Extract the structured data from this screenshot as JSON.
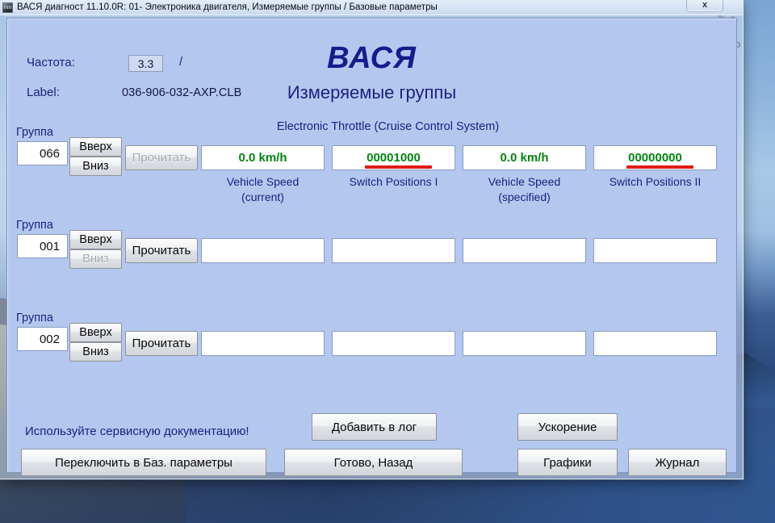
{
  "window": {
    "title": "ВАСЯ диагност 11.10.0R: 01- Электроника двигателя,  Измеряемые группы / Базовые параметры",
    "close_label": "x",
    "icon": "app-icon"
  },
  "desktop": {
    "watermark": "shop"
  },
  "header": {
    "freq_label": "Частота:",
    "freq_value": "3.3",
    "freq_separator": "/",
    "label_caption": "Label:",
    "label_value": "036-906-032-AXP.CLB",
    "brand": "ВАСЯ",
    "subtitle": "Измеряемые группы",
    "section_title": "Electronic Throttle (Cruise Control System)"
  },
  "groups": [
    {
      "caption": "Группа",
      "number": "066",
      "up_label": "Вверх",
      "down_label": "Вниз",
      "read_label": "Прочитать",
      "read_enabled": false,
      "up_enabled": true,
      "down_enabled": true,
      "fields": [
        {
          "value": "0.0 km/h",
          "label": "Vehicle Speed\n(current)",
          "label_line1": "Vehicle Speed",
          "label_line2": "(current)",
          "underlined": false
        },
        {
          "value": "00001000",
          "label": "Switch Positions I",
          "label_line1": "Switch Positions I",
          "label_line2": "",
          "underlined": true
        },
        {
          "value": "0.0 km/h",
          "label": "Vehicle Speed\n(specified)",
          "label_line1": "Vehicle Speed",
          "label_line2": "(specified)",
          "underlined": false
        },
        {
          "value": "00000000",
          "label": "Switch Positions II",
          "label_line1": "Switch Positions II",
          "label_line2": "",
          "underlined": true
        }
      ]
    },
    {
      "caption": "Группа",
      "number": "001",
      "up_label": "Вверх",
      "down_label": "Вниз",
      "read_label": "Прочитать",
      "read_enabled": true,
      "up_enabled": true,
      "down_enabled": false,
      "fields": [
        {
          "value": "",
          "label_line1": "",
          "label_line2": "",
          "underlined": false
        },
        {
          "value": "",
          "label_line1": "",
          "label_line2": "",
          "underlined": false
        },
        {
          "value": "",
          "label_line1": "",
          "label_line2": "",
          "underlined": false
        },
        {
          "value": "",
          "label_line1": "",
          "label_line2": "",
          "underlined": false
        }
      ]
    },
    {
      "caption": "Группа",
      "number": "002",
      "up_label": "Вверх",
      "down_label": "Вниз",
      "read_label": "Прочитать",
      "read_enabled": true,
      "up_enabled": true,
      "down_enabled": true,
      "fields": [
        {
          "value": "",
          "label_line1": "",
          "label_line2": "",
          "underlined": false
        },
        {
          "value": "",
          "label_line1": "",
          "label_line2": "",
          "underlined": false
        },
        {
          "value": "",
          "label_line1": "",
          "label_line2": "",
          "underlined": false
        },
        {
          "value": "",
          "label_line1": "",
          "label_line2": "",
          "underlined": false
        }
      ]
    }
  ],
  "footer": {
    "hint": "Используйте сервисную документацию!",
    "add_log": "Добавить в лог",
    "acceleration": "Ускорение",
    "switch_basic": "Переключить в Баз. параметры",
    "done_back": "Готово, Назад",
    "graphs": "Графики",
    "journal": "Журнал"
  },
  "colors": {
    "dialog_bg": "#b4c7ee",
    "text_blue": "#1b2280",
    "value_green": "#00860f",
    "annotation_red": "#e01b10"
  }
}
